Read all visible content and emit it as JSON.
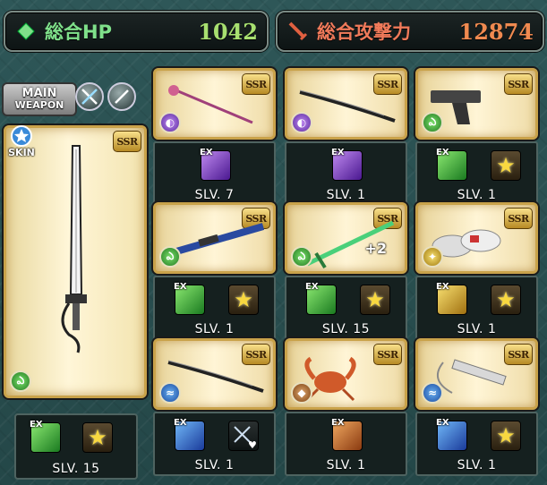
{
  "header": {
    "hp_label": "総合HP",
    "hp_value": "1042",
    "atk_label": "総合攻撃力",
    "atk_value": "12874"
  },
  "main_weapon": {
    "badge_line1": "MAIN",
    "badge_line2": "WEAPON",
    "skin_label": "SKIN",
    "rarity": "SSR",
    "element": "wind",
    "ex_label": "EX",
    "skill_level": "SLV. 15"
  },
  "grid": [
    {
      "rarity": "SSR",
      "element": "dark",
      "weapon": "staff-icon",
      "skills": [
        "dark-ex"
      ],
      "skill_level": "SLV. 7"
    },
    {
      "rarity": "SSR",
      "element": "dark",
      "weapon": "katana-icon",
      "skills": [
        "dark-ex"
      ],
      "skill_level": "SLV. 1"
    },
    {
      "rarity": "SSR",
      "element": "wind",
      "weapon": "gun-icon",
      "skills": [
        "wind-ex",
        "star"
      ],
      "skill_level": "SLV. 1"
    },
    {
      "rarity": "SSR",
      "element": "wind",
      "weapon": "rifle-icon",
      "skills": [
        "wind-ex",
        "star"
      ],
      "skill_level": "SLV. 1"
    },
    {
      "rarity": "SSR",
      "element": "wind",
      "weapon": "sword-icon",
      "plus": "+2",
      "skills": [
        "wind-ex",
        "star"
      ],
      "skill_level": "SLV. 15"
    },
    {
      "rarity": "SSR",
      "element": "light",
      "weapon": "gauntlet-icon",
      "skills": [
        "light-ex",
        "star"
      ],
      "skill_level": "SLV. 1"
    },
    {
      "rarity": "SSR",
      "element": "water",
      "weapon": "katana-icon",
      "skills": [
        "water-ex",
        "sword-heart"
      ],
      "skill_level": "SLV. 1"
    },
    {
      "rarity": "SSR",
      "element": "earth",
      "weapon": "crab-icon",
      "skills": [
        "earth-ex"
      ],
      "skill_level": "SLV. 1"
    },
    {
      "rarity": "SSR",
      "element": "water",
      "weapon": "whip-icon",
      "skills": [
        "water-ex",
        "star"
      ],
      "skill_level": "SLV. 1"
    }
  ],
  "ex_label": "EX",
  "colors": {
    "gold_border": "#c9a24a",
    "hp_text": "#a8e070",
    "atk_text": "#f08a50"
  }
}
